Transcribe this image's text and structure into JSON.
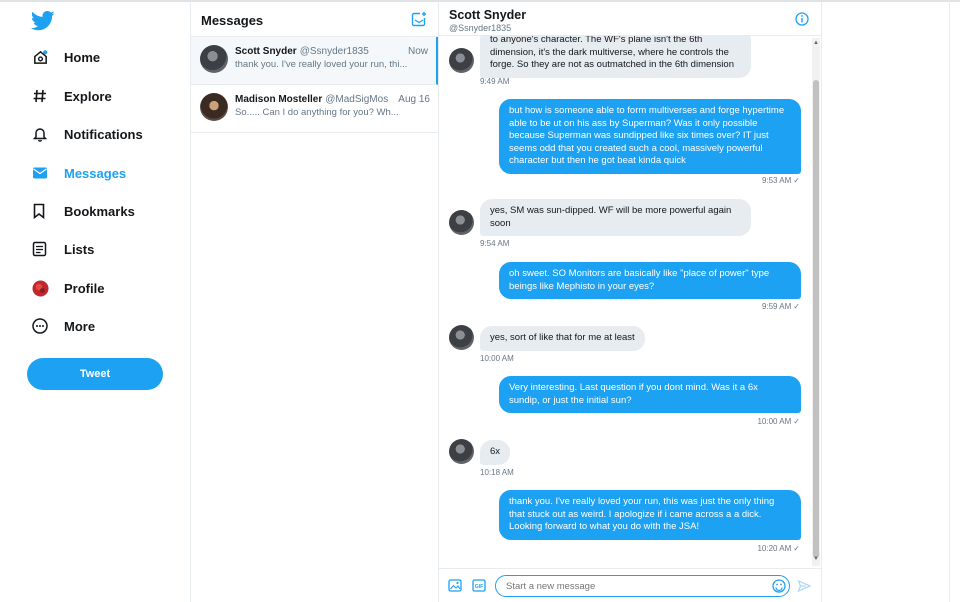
{
  "nav": {
    "items": [
      {
        "label": "Home",
        "icon": "home-icon"
      },
      {
        "label": "Explore",
        "icon": "hashtag-icon"
      },
      {
        "label": "Notifications",
        "icon": "bell-icon"
      },
      {
        "label": "Messages",
        "icon": "envelope-icon"
      },
      {
        "label": "Bookmarks",
        "icon": "bookmark-icon"
      },
      {
        "label": "Lists",
        "icon": "list-icon"
      },
      {
        "label": "Profile",
        "icon": "profile-avatar-icon"
      },
      {
        "label": "More",
        "icon": "more-circle-icon"
      }
    ],
    "tweet_label": "Tweet"
  },
  "list": {
    "title": "Messages",
    "conversations": [
      {
        "name": "Scott Snyder",
        "handle": "@Ssnyder1835",
        "time": "Now",
        "preview": "thank you. I've really loved your run, thi..."
      },
      {
        "name": "Madison Mosteller",
        "handle": "@MadSigMos",
        "time": "Aug 16",
        "preview": "So..... Can I do anything for you? Wh..."
      }
    ]
  },
  "chat": {
    "name": "Scott Snyder",
    "handle": "@Ssnyder1835",
    "messages": [
      {
        "dir": "in",
        "lines": [
          "to anyone's character. The WF's plane isn't the 6th",
          "dimension, it's the dark multiverse, where he controls the",
          "forge. So they are not as outmatched in the 6th  dimension"
        ],
        "time": "9:49 AM"
      },
      {
        "dir": "out",
        "lines": [
          "but how is someone able to form multiverses and forge hypertime",
          "able to be ut on his ass by Superman?  Was it only possible",
          "because Superman was sundipped like six times over?  IT just",
          "seems odd that you created such a cool, massively powerful",
          "character but then he got beat kinda quick"
        ],
        "time": "9:53 AM"
      },
      {
        "dir": "in",
        "lines": [
          "yes, SM was sun-dipped. WF will be more powerful again",
          "soon"
        ],
        "time": "9:54 AM"
      },
      {
        "dir": "out",
        "lines": [
          "oh sweet.  SO Monitors are basically like \"place of power\" type",
          "beings like Mephisto in your eyes?"
        ],
        "time": "9:59 AM"
      },
      {
        "dir": "in",
        "lines": [
          "yes, sort of like that for me at least"
        ],
        "time": "10:00 AM"
      },
      {
        "dir": "out",
        "lines": [
          "Very interesting.  Last question if you dont mind.  Was it a 6x",
          "sundip, or just the initial sun?"
        ],
        "time": "10:00 AM"
      },
      {
        "dir": "in",
        "lines": [
          "6x"
        ],
        "time": "10:18 AM"
      },
      {
        "dir": "out",
        "lines": [
          "thank you.  I've really loved your run, this was just the only thing",
          "that stuck out as weird.   I apologize if i came across a a dick.",
          "Looking forward to what you do with the JSA!"
        ],
        "time": "10:20 AM"
      }
    ],
    "check": "✓",
    "input_placeholder": "Start a new message"
  },
  "colors": {
    "accent": "#1da1f2",
    "bubble_in": "#e6ecf0",
    "text_secondary": "#657786"
  }
}
